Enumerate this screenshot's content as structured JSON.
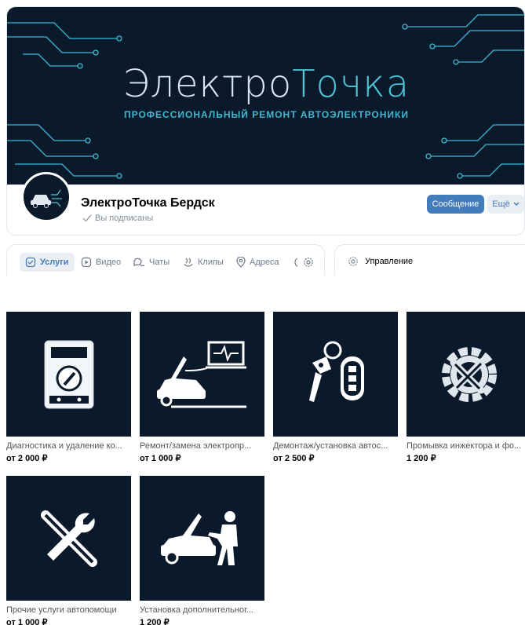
{
  "cover": {
    "brand_part1": "Электро",
    "brand_part2": "Точка",
    "tagline": "ПРОФЕССИОНАЛЬНЫЙ РЕМОНТ АВТОЭЛЕКТРОНИКИ"
  },
  "community": {
    "name": "ЭлектроТочка Бердск",
    "status": "Вы подписаны",
    "message_button": "Сообщение",
    "more_button": "Ещё"
  },
  "tabs": [
    {
      "label": "Услуги",
      "icon": "services-icon",
      "active": true
    },
    {
      "label": "Видео",
      "icon": "video-icon",
      "active": false
    },
    {
      "label": "Чаты",
      "icon": "chats-icon",
      "active": false
    },
    {
      "label": "Клипы",
      "icon": "clips-icon",
      "active": false
    },
    {
      "label": "Адреса",
      "icon": "location-icon",
      "active": false
    }
  ],
  "manage": {
    "label": "Управление",
    "icon": "gear-icon"
  },
  "services": [
    {
      "title": "Диагностика и удаление ко...",
      "price": "от 2 000 ₽",
      "icon": "multimeter-icon"
    },
    {
      "title": "Ремонт/замена электропр...",
      "price": "от 1 000 ₽",
      "icon": "car-diagnostic-icon"
    },
    {
      "title": "Демонтаж/установка автос...",
      "price": "от 2 500 ₽",
      "icon": "car-key-icon"
    },
    {
      "title": "Промывка инжектора и фо...",
      "price": "1 200 ₽",
      "icon": "wrench-gear-icon"
    },
    {
      "title": "Прочие услуги автопомощи",
      "price": "от 1 000 ₽",
      "icon": "tools-icon"
    },
    {
      "title": "Установка дополнительног...",
      "price": "1 200 ₽",
      "icon": "mechanic-icon"
    }
  ],
  "colors": {
    "accent": "#447bba",
    "navy": "#0a1a2b",
    "cyan": "#4fc3d6"
  }
}
